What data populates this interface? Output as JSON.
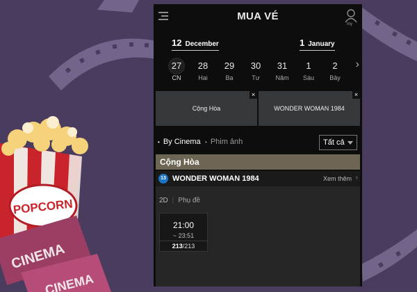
{
  "header": {
    "title": "MUA VÉ",
    "account_label": "my"
  },
  "calendar": {
    "month_start": {
      "day": "12",
      "month": "December"
    },
    "month_end": {
      "day": "1",
      "month": "January"
    },
    "dates": [
      {
        "num": "27",
        "dow": "CN"
      },
      {
        "num": "28",
        "dow": "Hai"
      },
      {
        "num": "29",
        "dow": "Ba"
      },
      {
        "num": "30",
        "dow": "Tư"
      },
      {
        "num": "31",
        "dow": "Năm"
      },
      {
        "num": "1",
        "dow": "Sáu"
      },
      {
        "num": "2",
        "dow": "Bảy"
      }
    ],
    "selected_index": 0
  },
  "filters": [
    {
      "label": "Cộng Hòa",
      "close": "×"
    },
    {
      "label": "WONDER WOMAN 1984",
      "close": "×"
    }
  ],
  "tabs": {
    "by_cinema": "By Cinema",
    "by_movie": "Phim ảnh",
    "select_value": "Tất cả"
  },
  "cinema": {
    "name": "Cộng Hòa"
  },
  "movie": {
    "rating": "13",
    "title": "WONDER WOMAN 1984",
    "see_more": "Xem thêm"
  },
  "showtimes": {
    "format": "2D",
    "subtitle": "Phụ đề",
    "slots": [
      {
        "start": "21:00",
        "end": "~ 23:51",
        "available": "213",
        "total": "/213"
      }
    ]
  },
  "decoration": {
    "popcorn_text": "POPCORN",
    "ticket_text_1": "CINEMA",
    "ticket_text_2": "CINEMA",
    "colors": {
      "accent": "#6e6654",
      "rating": "#1b73c4",
      "background": "#4a3c5e"
    }
  }
}
